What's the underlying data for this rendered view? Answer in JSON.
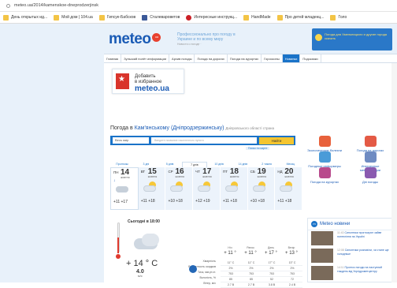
{
  "browser": {
    "url": "meteo.ua/2014/kamenskoe-dneprodzerjinsk",
    "bookmarks": [
      "День открытых ид...",
      "Мой дом | 104.ua",
      "Гипсуе-Бабсков",
      "Сталевароветов",
      "Интересные инструкц...",
      "HandMade",
      "Про детей младенц...",
      "Голо"
    ]
  },
  "header": {
    "logo": "meteo",
    "logo_badge": "ua",
    "tagline": "Профессионально про погоду в Украине и по всему миру",
    "tagline_sub": "Новости о погоде · ",
    "banner": "Погода для Хмельницкого и другие города скачать"
  },
  "nav": [
    "Главная",
    "Зульский полёт информации",
    "Архив погоды",
    "Погода на дорогах",
    "Погода на курортах",
    "Гороскопы",
    "Новинки",
    "Подсказки"
  ],
  "favorite": {
    "line1": "Добавить",
    "line2": "в избранное",
    "line3": "meteo.ua"
  },
  "title": {
    "prefix": "Погода в",
    "city": "Кам'янському (Дніпродзержинську)",
    "district": "Дніпровського області страна"
  },
  "search": {
    "select": "Весь мир",
    "placeholder": "Введите название населенного пункта",
    "button": "Найти",
    "link": "Поиск по карте"
  },
  "services": [
    {
      "label": "Экологические болезни",
      "color": "#e8613b"
    },
    {
      "label": "Погода на дорогах",
      "color": "#e45a45"
    },
    {
      "label": "Погодные информеры",
      "color": "#4a9bd8"
    },
    {
      "label": "Интересные метеостанции",
      "color": "#6e8bc2"
    },
    {
      "label": "Погода на курортах",
      "color": "#b84a8c"
    },
    {
      "label": "Дні погоды",
      "color": "#8a5ab0"
    }
  ],
  "tabs": [
    "Прогнозы",
    "3 дні",
    "5 днів",
    "7 днів",
    "10 днів",
    "14 днів",
    "2 тижня",
    "Месяц"
  ],
  "days": [
    {
      "dn": "ПН",
      "dd": "14",
      "mo": "жовтня",
      "t": "+11 +17",
      "today": true
    },
    {
      "dn": "ВТ",
      "dd": "15",
      "mo": "жовтня",
      "t": "+11 +18"
    },
    {
      "dn": "СР",
      "dd": "16",
      "mo": "жовтня",
      "t": "+10 +18"
    },
    {
      "dn": "ЧТ",
      "dd": "17",
      "mo": "жовтня",
      "t": "+12 +19"
    },
    {
      "dn": "ПТ",
      "dd": "18",
      "mo": "жовтня",
      "t": "+11 +18"
    },
    {
      "dn": "СБ",
      "dd": "19",
      "mo": "жовтня",
      "t": "+10 +18"
    },
    {
      "dn": "НД",
      "dd": "20",
      "mo": "жовтня",
      "t": "+11 +18"
    }
  ],
  "now": {
    "title": "Сьогодні в 18:00",
    "temp": "+ 14 ° C",
    "wind_value": "4.0",
    "wind_unit": "м/с",
    "labels": [
      "Хмарність",
      "Вероятность осадков",
      "Тиск, мм.рт.ст.",
      "Вологість, %",
      "Вітер, м/с"
    ],
    "periods": [
      {
        "name": "Ніч",
        "t": "+ 11 °"
      },
      {
        "name": "Ранок",
        "t": "+ 11 °"
      },
      {
        "name": "День",
        "t": "+ 17 °"
      },
      {
        "name": "Вечір",
        "t": "+ 13 °"
      }
    ],
    "rows": [
      [
        "11° C",
        "11° C",
        "17° C",
        "13° C"
      ],
      [
        "2%",
        "2%",
        "2%",
        "2%"
      ],
      [
        "753",
        "753",
        "753",
        "753"
      ],
      [
        "85",
        "85",
        "52",
        "72"
      ],
      [
        "2.7 В",
        "2.7 В",
        "3.8 В",
        "2.4 В"
      ]
    ]
  },
  "news": {
    "header": "Meteo новини",
    "items": [
      {
        "text": "Синоптики прогнозуют зайве потепління на Україні",
        "time": "11:43"
      },
      {
        "text": "Синоптики розповіли, чи стане ще холодніше",
        "time": "12:08"
      },
      {
        "text": "Прогноз погоди на наступний тиждень від Укргідрометцентру",
        "time": "14:11"
      }
    ]
  }
}
